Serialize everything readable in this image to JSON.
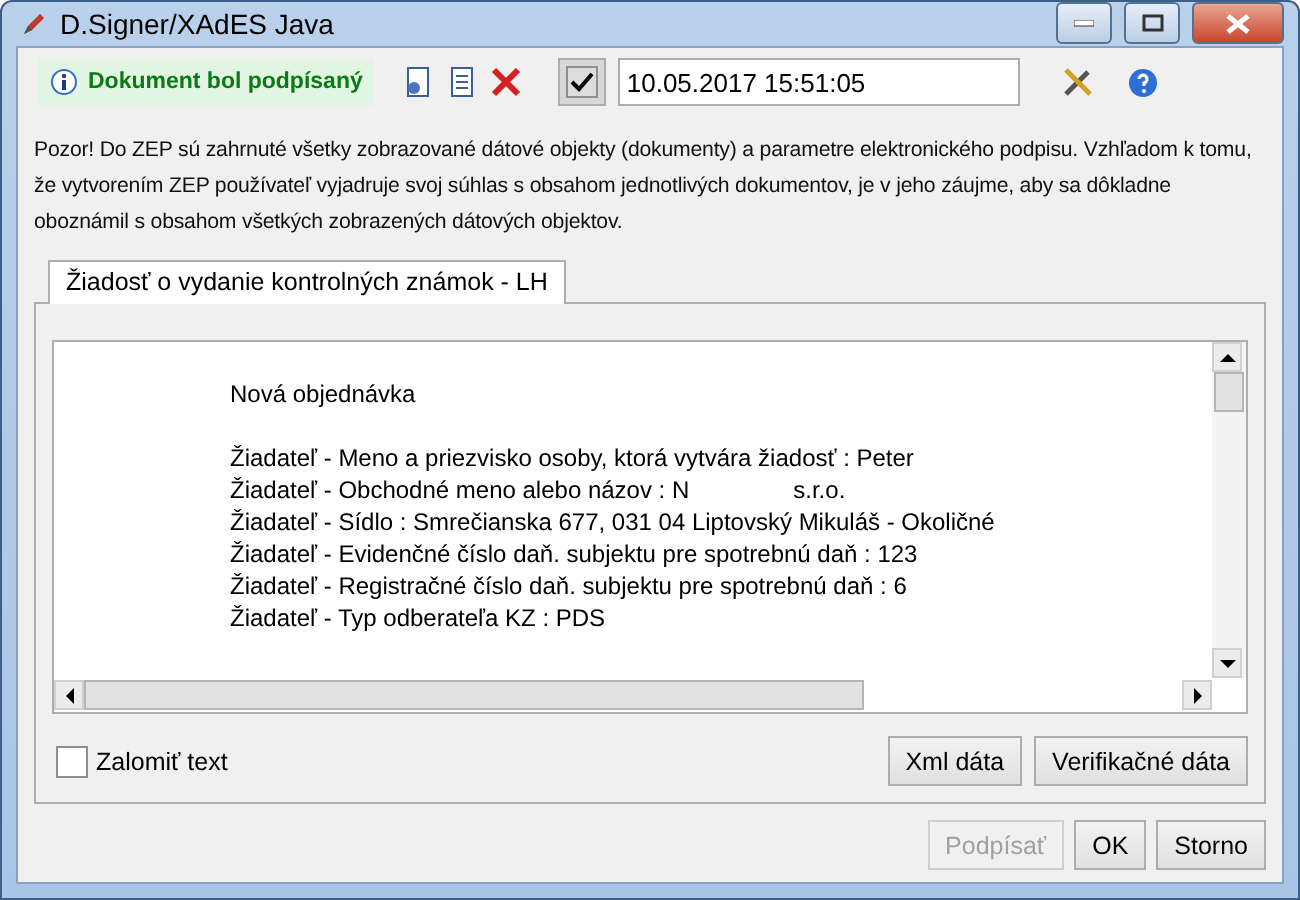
{
  "window": {
    "title": "D.Signer/XAdES Java"
  },
  "toolbar": {
    "status": "Dokument bol podpísaný",
    "timestamp_enabled": true,
    "timestamp": "10.05.2017 15:51:05"
  },
  "notice": "Pozor! Do ZEP sú zahrnuté všetky zobrazované dátové objekty (dokumenty) a parametre elektronického podpisu. Vzhľadom k tomu, že vytvorením ZEP používateľ vyjadruje svoj súhlas s obsahom jednotlivých dokumentov, je v jeho záujme, aby sa dôkladne oboznámil s obsahom všetkých zobrazených dátových objektov.",
  "tabs": [
    {
      "label": "Žiadosť o vydanie kontrolných známok - LH",
      "selected": true
    }
  ],
  "document": {
    "heading": "Nová objednávka",
    "lines": [
      {
        "text": "Žiadateľ - Meno a priezvisko osoby, ktorá vytvára žiadosť : Peter"
      },
      {
        "text": "Žiadateľ - Obchodné meno alebo názov : N",
        "tail": "s.r.o."
      },
      {
        "text": "Žiadateľ - Sídlo : Smrečianska 677, 031 04 Liptovský Mikuláš - Okoličné"
      },
      {
        "text": "Žiadateľ - Evidenčné číslo daň. subjektu pre spotrebnú daň : 123"
      },
      {
        "text": "Žiadateľ - Registračné číslo daň. subjektu pre spotrebnú daň : 6"
      },
      {
        "text": "Žiadateľ - Typ odberateľa KZ : PDS"
      }
    ]
  },
  "wrap_text": {
    "label": "Zalomiť text",
    "checked": false
  },
  "panel_buttons": [
    {
      "label": "Xml dáta",
      "disabled": false
    },
    {
      "label": "Verifikačné dáta",
      "disabled": false
    }
  ],
  "dialog_buttons": [
    {
      "label": "Podpísať",
      "disabled": true
    },
    {
      "label": "OK",
      "disabled": false
    },
    {
      "label": "Storno",
      "disabled": false
    }
  ]
}
